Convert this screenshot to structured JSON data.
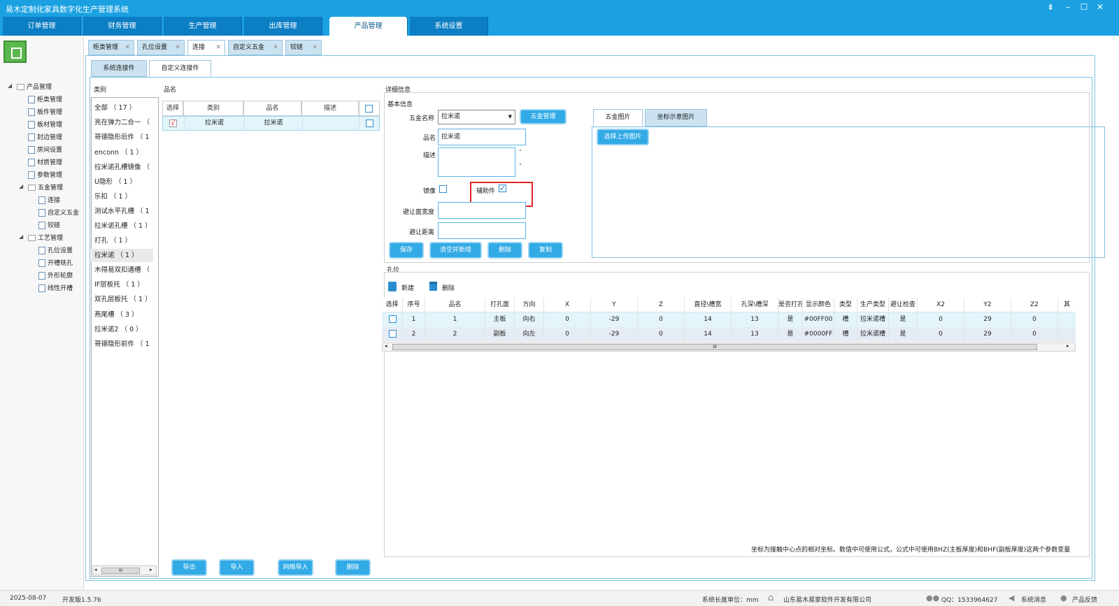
{
  "app": {
    "title": "易木定制化家具数字化生产管理系统"
  },
  "nav_tabs": [
    "订单管理",
    "财务管理",
    "生产管理",
    "出库管理",
    "产品管理",
    "系统设置"
  ],
  "active_nav": "产品管理",
  "tree": {
    "product_mgmt": "产品管理",
    "items": [
      "柜类管理",
      "板件管理",
      "板材管理",
      "封边管理",
      "房间设置",
      "材质管理",
      "参数管理"
    ],
    "hardware": "五金管理",
    "hardware_items": [
      "连接",
      "自定义五金",
      "铰链"
    ],
    "process": "工艺管理",
    "process_items": [
      "孔位设置",
      "开槽铣孔",
      "外形轮廓",
      "线性开槽"
    ]
  },
  "doc_tabs": [
    "柜类管理",
    "孔位设置",
    "连接",
    "自定义五金",
    "铰链"
  ],
  "sub_tabs": [
    "系统连接件",
    "自定义连接件"
  ],
  "category": {
    "header": "类别",
    "items": [
      "全部 （ 17 ）",
      "亮在弹力二合一 （",
      "哥德隐形后件 （ 1",
      "enconn （ 1 ）",
      "拉米诺孔槽镜像 （",
      "U隐形 （ 1 ）",
      "乐扣 （ 1 ）",
      "测试水平孔槽 （ 1",
      "拉米诺孔槽 （ 1 ）",
      "打孔 （ 1 ）",
      "拉米诺 （ 1 ）",
      "木得易双扣通槽 （",
      "IF层板托 （ 1 ）",
      "双孔层板托 （ 1 ）",
      "燕尾槽 （ 3 ）",
      "拉米诺2 （ 0 ）",
      "哥德隐形前件 （ 1"
    ],
    "scroll_mark": "III"
  },
  "pinming": {
    "header": "品名",
    "columns": [
      "选择",
      "类别",
      "品名",
      "描述"
    ],
    "rows": [
      {
        "check": "√",
        "category": "拉米诺",
        "name": "拉米诺",
        "desc": ""
      }
    ]
  },
  "bottom_buttons": [
    "导出",
    "导入",
    "网络导入",
    "删除"
  ],
  "detail": {
    "title": "详细信息",
    "basic": "基本信息",
    "hw_name_label": "五金名称",
    "hw_name_value": "拉米诺",
    "hw_mgmt_btn": "五金管理",
    "name_label": "品名",
    "name_value": "拉米诺",
    "desc_label": "描述",
    "mirror_label": "镜像",
    "aux_label": "辅助件",
    "aux_check": "✓",
    "avoid_w_label": "避让面宽度",
    "avoid_d_label": "避让距离",
    "buttons": [
      "保存",
      "清空并新增",
      "删除",
      "复制"
    ],
    "img_tabs": [
      "五金图片",
      "坐标示意图片"
    ],
    "upload_btn": "选择上传图片"
  },
  "holes": {
    "title": "孔位",
    "new_label": "新建",
    "delete_label": "删除",
    "columns": [
      "选择",
      "序号",
      "品名",
      "打孔面",
      "方向",
      "X",
      "Y",
      "Z",
      "直径\\槽宽",
      "孔深\\槽深",
      "是否打孔",
      "显示颜色",
      "类型",
      "生产类型",
      "避让检查",
      "X2",
      "Y2",
      "Z2",
      "其"
    ],
    "rows": [
      [
        "",
        "1",
        "1",
        "主板",
        "向右",
        "0",
        "-29",
        "0",
        "14",
        "13",
        "是",
        "#00FF00",
        "槽",
        "拉米诺槽",
        "是",
        "0",
        "29",
        "0"
      ],
      [
        "",
        "2",
        "2",
        "副板",
        "向左",
        "0",
        "-29",
        "0",
        "14",
        "13",
        "是",
        "#0000FF",
        "槽",
        "拉米诺槽",
        "是",
        "0",
        "29",
        "0"
      ]
    ],
    "scroll_mark": "III",
    "note": "坐标为接触中心点的相对坐标。数值中可使用公式，公式中可使用BHZ(主板厚度)和BHF(副板厚度)这两个参数变量"
  },
  "status": {
    "date": "2025-08-07",
    "version": "开发版1.5.76",
    "unit": "系统长度单位：mm",
    "company": "山东易木易家软件开发有限公司",
    "qq": "QQ：1533964627",
    "msg": "系统消息",
    "feedback": "产品反馈"
  },
  "colors": {
    "accent": "#1ba1e2",
    "button": "#32aae6",
    "highlight_red": "#e02424"
  }
}
